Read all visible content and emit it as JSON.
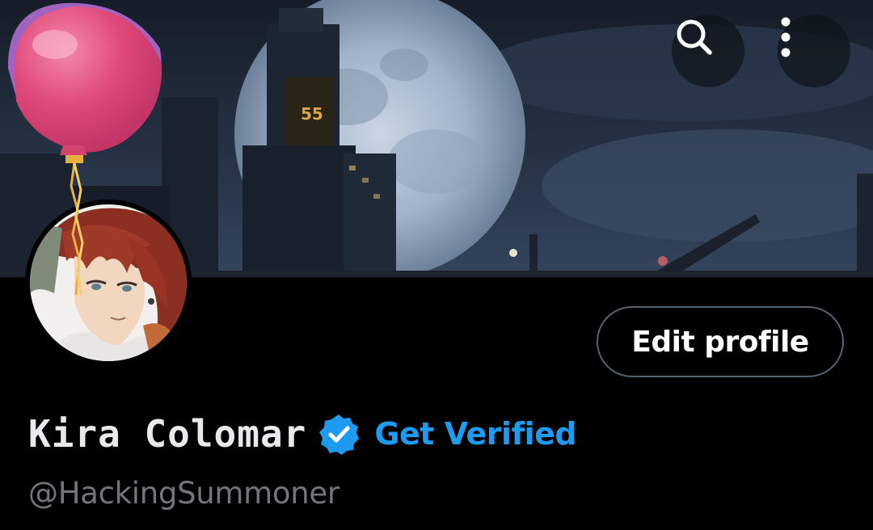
{
  "header": {
    "icons": {
      "search": "search-icon",
      "more": "more-vertical-icon"
    }
  },
  "banner": {
    "description_icon": "city-moon-banner",
    "sign_text": "55"
  },
  "profile": {
    "display_name": "Kira Colomar",
    "verified_icon": "verified-badge-icon",
    "get_verified_label": "Get Verified",
    "handle": "@HackingSummoner",
    "edit_profile_label": "Edit profile",
    "avatar_icon": "anime-avatar",
    "birthday_icon": "balloon-icon"
  },
  "colors": {
    "background": "#000000",
    "accent_blue": "#1d9bf0",
    "handle_gray": "#71767b",
    "button_border": "#536471",
    "balloon_pink": "#e0487a"
  }
}
